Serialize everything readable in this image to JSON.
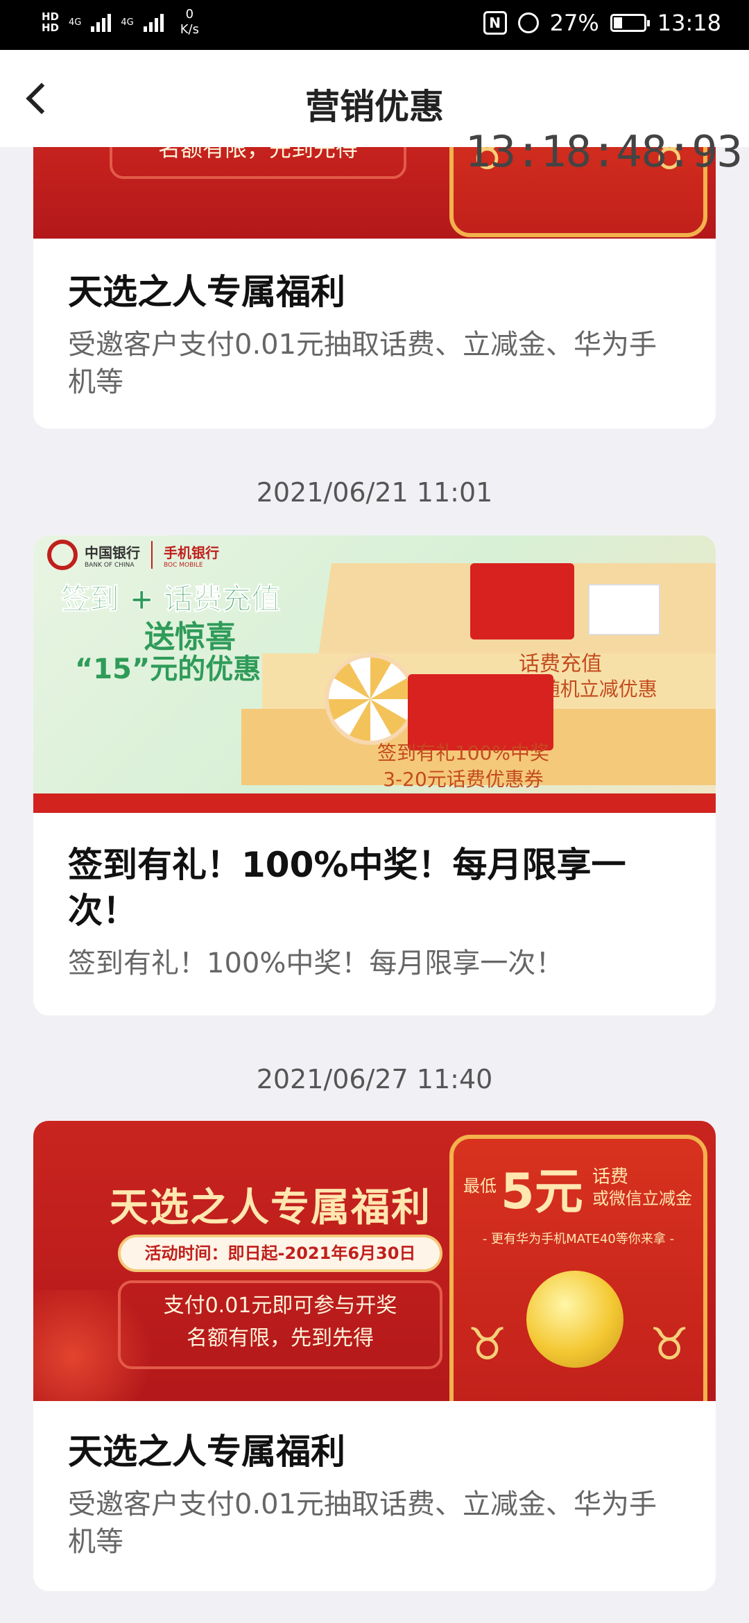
{
  "status": {
    "hd1": "HD",
    "hd2": "HD",
    "net1": "4G",
    "net2": "4G",
    "speed_value": "0",
    "speed_unit": "K/s",
    "nfc": "N",
    "battery": "27%",
    "time": "13:18"
  },
  "nav": {
    "title": "营销优惠"
  },
  "overlay_time": "13:18:48:93",
  "card1": {
    "banner_text": "名额有限，先到先得",
    "title": "天选之人专属福利",
    "desc": "受邀客户支付0.01元抽取话费、立减金、华为手机等"
  },
  "date2": "2021/06/21 11:01",
  "card2": {
    "bank_name": "中国银行",
    "bank_en": "BANK OF CHINA",
    "app_name": "手机银行",
    "app_en": "BOC MOBILE",
    "headline1": "签到 + 话费充值",
    "headline2": "送惊喜",
    "headline3": "“15”元的优惠",
    "tag1": "话费充值",
    "tag2": "2-20元随机立减优惠",
    "tag3": "签到有礼100%中奖",
    "tag4": "3-20元话费优惠券",
    "title": "签到有礼！100%中奖！每月限享一次！",
    "desc": "签到有礼！100%中奖！每月限享一次！"
  },
  "date3": "2021/06/27 11:40",
  "card3": {
    "banner_title": "天选之人专属福利",
    "banner_time": "活动时间：即日起-2021年6月30日",
    "banner_line1": "支付0.01元即可参与开奖",
    "banner_line2": "名额有限，先到先得",
    "env_low": "最低",
    "env_amount": "5元",
    "env_type1": "话费",
    "env_type2": "或微信立减金",
    "env_more": "- 更有华为手机MATE40等你来拿 -",
    "title": "天选之人专属福利",
    "desc": "受邀客户支付0.01元抽取话费、立减金、华为手机等"
  },
  "colors": {
    "accent_red": "#c0201c",
    "gold": "#f2b24c",
    "background": "#f1f1f5"
  }
}
